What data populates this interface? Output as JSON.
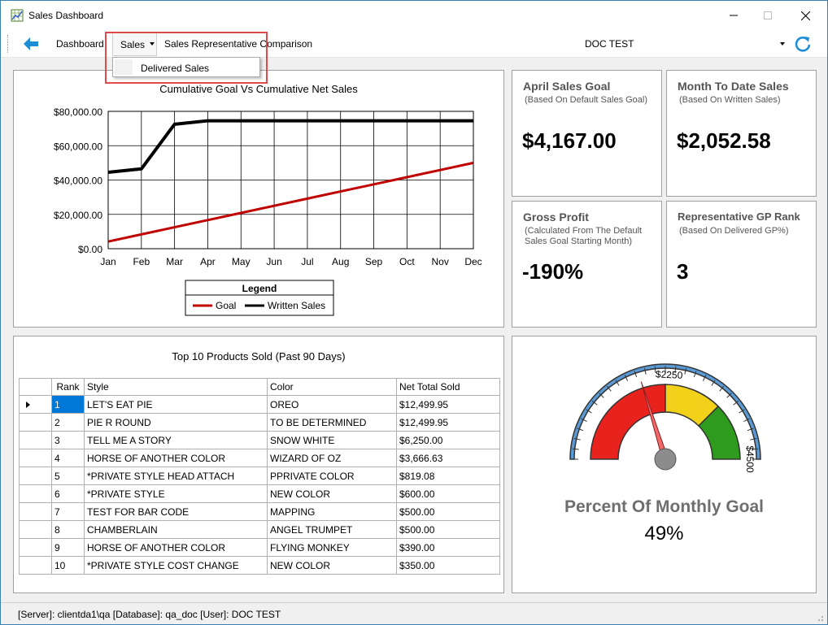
{
  "window": {
    "title": "Sales Dashboard"
  },
  "toolbar": {
    "dashboard_label": "Dashboard",
    "sales_label": "Sales",
    "comparison_label": "Sales Representative Comparison",
    "doc_select_value": "DOC TEST"
  },
  "sales_menu": {
    "items": [
      {
        "label": "Delivered Sales"
      }
    ]
  },
  "chart_data": {
    "type": "line",
    "title": "Cumulative Goal Vs Cumulative Net Sales",
    "categories": [
      "Jan",
      "Feb",
      "Mar",
      "Apr",
      "May",
      "Jun",
      "Jul",
      "Aug",
      "Sep",
      "Oct",
      "Nov",
      "Dec"
    ],
    "ylim": [
      0,
      80000
    ],
    "yticks": [
      "$80,000.00",
      "$60,000.00",
      "$40,000.00",
      "$20,000.00",
      "$0.00"
    ],
    "ytick_values": [
      80000,
      60000,
      40000,
      20000,
      0
    ],
    "grid": true,
    "legend": {
      "title": "Legend",
      "position": "bottom"
    },
    "series": [
      {
        "name": "Goal",
        "color": "#c00000",
        "values": [
          4167,
          8333,
          12500,
          16667,
          20833,
          25000,
          29167,
          33333,
          37500,
          41667,
          45833,
          50000
        ]
      },
      {
        "name": "Written Sales",
        "color": "#000000",
        "values": [
          44500,
          46500,
          72500,
          74500,
          74500,
          74500,
          74500,
          74500,
          74500,
          74500,
          74500,
          74500
        ]
      }
    ]
  },
  "cards": [
    {
      "title": "April Sales Goal",
      "subtitle": "(Based On Default Sales Goal)",
      "value": "$4,167.00"
    },
    {
      "title": "Month To Date Sales",
      "subtitle": "(Based On Written Sales)",
      "value": "$2,052.58"
    },
    {
      "title": "Gross Profit",
      "subtitle": "(Calculated From The Default Sales Goal Starting Month)",
      "value": "-190%"
    },
    {
      "title": "Representative GP Rank",
      "subtitle": "(Based On Delivered GP%)",
      "value": "3"
    }
  ],
  "products": {
    "title": "Top 10 Products Sold (Past 90 Days)",
    "columns": [
      "Rank",
      "Style",
      "Color",
      "Net Total Sold"
    ],
    "rows": [
      [
        "1",
        "LET'S EAT PIE",
        "OREO",
        "$12,499.95"
      ],
      [
        "2",
        "PIE R ROUND",
        "TO BE DETERMINED",
        "$12,499.95"
      ],
      [
        "3",
        "TELL ME A STORY",
        "SNOW WHITE",
        "$6,250.00"
      ],
      [
        "4",
        "HORSE OF ANOTHER COLOR",
        "WIZARD OF OZ",
        "$3,666.63"
      ],
      [
        "5",
        "*PRIVATE STYLE  HEAD ATTACH",
        "PPRIVATE COLOR",
        "$819.08"
      ],
      [
        "6",
        "*PRIVATE STYLE",
        "NEW COLOR",
        "$600.00"
      ],
      [
        "7",
        "TEST FOR BAR CODE",
        "MAPPING",
        "$500.00"
      ],
      [
        "8",
        "CHAMBERLAIN",
        "ANGEL TRUMPET",
        "$500.00"
      ],
      [
        "9",
        "HORSE OF ANOTHER COLOR",
        "FLYING MONKEY",
        "$390.00"
      ],
      [
        "10",
        "*PRIVATE STYLE COST CHANGE",
        "NEW COLOR",
        "$350.00"
      ]
    ]
  },
  "gauge": {
    "label": "Percent Of Monthly Goal",
    "value_text": "49%",
    "max": 4167,
    "needle_value": 2052.58,
    "tick_labels": [
      {
        "value": 2250,
        "text": "$2250"
      },
      {
        "value": 4500,
        "text": "$4500"
      }
    ],
    "bands": [
      {
        "from": 0,
        "to": 0.5,
        "color": "#e8231e"
      },
      {
        "from": 0.5,
        "to": 0.75,
        "color": "#f2d11b"
      },
      {
        "from": 0.75,
        "to": 1.0,
        "color": "#2e9a1e"
      }
    ],
    "scale_color": "#5b9bd5"
  },
  "status": {
    "text": "[Server]: clientda1\\qa  [Database]: qa_doc  [User]: DOC TEST"
  }
}
